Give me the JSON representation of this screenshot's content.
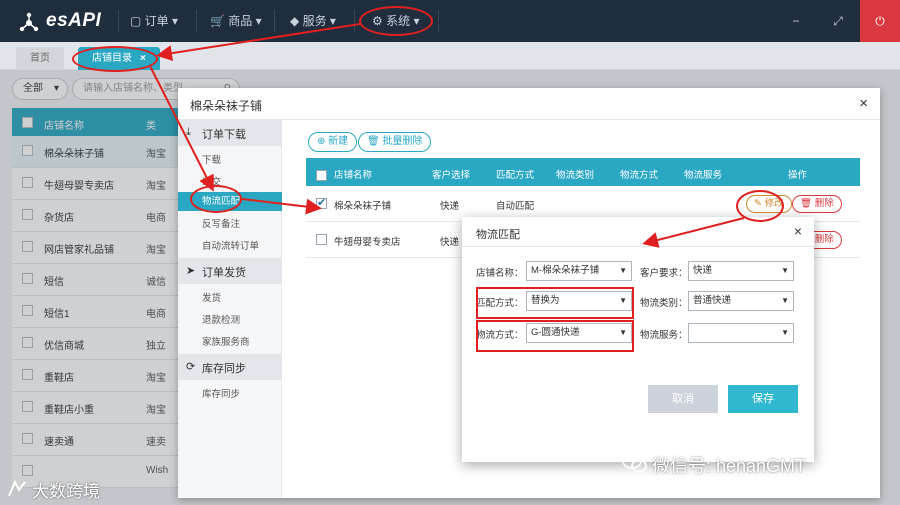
{
  "app": {
    "logo_text": "esAPI"
  },
  "nav": {
    "items": [
      "订单",
      "商品",
      "服务",
      "系统"
    ]
  },
  "window_controls": {
    "minimize": "−",
    "maximize": "⤢",
    "close": "⏻"
  },
  "tabs": [
    {
      "label": "首页"
    },
    {
      "label": "店铺目录",
      "close": "×"
    }
  ],
  "background_page": {
    "filter_all": "全部",
    "search_placeholder": "请输入店铺名称、类型",
    "columns": [
      "店铺名称",
      "类"
    ],
    "rows": [
      {
        "name": "棉朵朵袜子铺",
        "type": "淘宝"
      },
      {
        "name": "牛翅母婴专卖店",
        "type": "淘宝"
      },
      {
        "name": "杂货店",
        "type": "电商"
      },
      {
        "name": "网店管家礼品铺",
        "type": "淘宝"
      },
      {
        "name": "短信",
        "type": "诚信"
      },
      {
        "name": "短信1",
        "type": "电商"
      },
      {
        "name": "优信商城",
        "type": "独立"
      },
      {
        "name": "重鞋店",
        "type": "淘宝"
      },
      {
        "name": "重鞋店小重",
        "type": "淘宝"
      },
      {
        "name": "速卖通",
        "type": "速卖"
      },
      {
        "name": "",
        "type": "Wish"
      }
    ]
  },
  "modal1": {
    "title": "棉朵朵袜子铺",
    "close": "×",
    "sidebar": [
      {
        "group": "订单下载",
        "items": [
          "下载",
          "递交",
          "物流匹配",
          "反写备注",
          "自动流转订单"
        ]
      },
      {
        "group": "订单发货",
        "items": [
          "发货",
          "退款检测",
          "家族服务商"
        ]
      },
      {
        "group": "库存同步",
        "items": [
          "库存同步"
        ]
      }
    ],
    "buttons": {
      "new": "新建",
      "batch_delete": "批量删除"
    },
    "columns": [
      "店铺名称",
      "客户选择",
      "匹配方式",
      "物流类别",
      "物流方式",
      "物流服务",
      "操作"
    ],
    "rows": [
      {
        "name": "棉朵朵袜子铺",
        "customer": "快递",
        "match": "自动匹配",
        "edit": "修改",
        "delete": "删除",
        "checked": true
      },
      {
        "name": "牛翅母婴专卖店",
        "customer": "快递",
        "match": "",
        "edit": "",
        "delete": "删除",
        "checked": false
      }
    ]
  },
  "modal2": {
    "title": "物流匹配",
    "close": "×",
    "fields": {
      "shop_label": "店铺名称：",
      "shop_value": "M-棉朵朵袜子铺",
      "customer_label": "客户要求：",
      "customer_value": "快递",
      "match_label": "匹配方式：",
      "match_value": "替换为",
      "logistics_type_label": "物流类别：",
      "logistics_type_value": "普通快递",
      "logistics_method_label": "物流方式：",
      "logistics_method_value": "G-圆通快递",
      "logistics_service_label": "物流服务：",
      "logistics_service_value": ""
    },
    "cancel": "取消",
    "save": "保存"
  },
  "watermarks": {
    "wechat": "微信号: henanGMT",
    "brand": "大数跨境"
  },
  "colors": {
    "nav_bg": "#1f2d3d",
    "accent": "#2aa7c2",
    "annotation": "#e02020"
  }
}
